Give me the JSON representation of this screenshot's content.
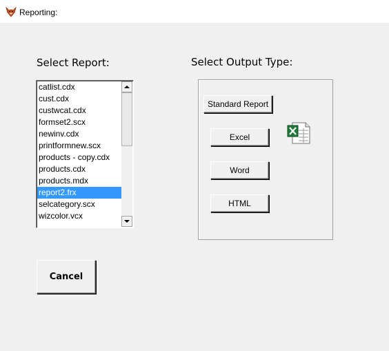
{
  "window": {
    "title": "Reporting:",
    "icon": "fox-icon"
  },
  "select_report": {
    "heading": "Select Report:",
    "items": [
      "catlist.cdx",
      "cust.cdx",
      "custwcat.cdx",
      "formset2.scx",
      "newinv.cdx",
      "printformnew.scx",
      "products - copy.cdx",
      "products.cdx",
      "products.mdx",
      "report2.frx",
      "selcategory.scx",
      "wizcolor.vcx"
    ],
    "selected": "report2.frx"
  },
  "output": {
    "heading": "Select Output Type:",
    "standard_label": "Standard Report",
    "excel_label": "Excel",
    "word_label": "Word",
    "html_label": "HTML",
    "excel_icon": "excel-icon"
  },
  "cancel_label": "Cancel",
  "colors": {
    "selection": "#3399ff",
    "window_bg": "#f0f0f0",
    "excel_green": "#1f7a3a"
  }
}
